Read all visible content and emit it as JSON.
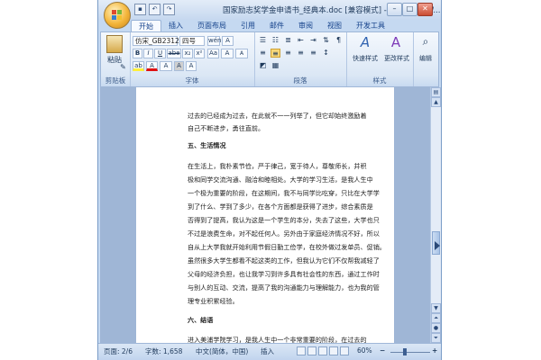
{
  "window": {
    "title": "国家励志奖学金申请书_经典本.doc [兼容模式] - Microsoft W...",
    "min_label": "–",
    "max_label": "□",
    "close_label": "✕"
  },
  "tabs": [
    "开始",
    "插入",
    "页面布局",
    "引用",
    "邮件",
    "审阅",
    "视图",
    "开发工具"
  ],
  "ribbon": {
    "clipboard": {
      "label": "剪贴板",
      "paste_label": "粘贴"
    },
    "font": {
      "label": "字体",
      "font_name": "仿宋_GB2312",
      "font_size": "四号",
      "wen": "wén",
      "a_big": "A",
      "a_small": "A",
      "aa": "Aa",
      "bold": "B",
      "italic": "I",
      "underline": "U",
      "strike": "abe",
      "sub": "x₂",
      "sup": "x²",
      "highlight": "ab",
      "font_color": "A",
      "clear": "A"
    },
    "paragraph": {
      "label": "段落"
    },
    "styles": {
      "label": "样式",
      "quick_styles": "快速样式",
      "change_styles": "更改样式"
    },
    "editing": {
      "label": "编辑"
    }
  },
  "document": {
    "lines": [
      "过去的已经成为过去，在此就不一一列举了，但它却始终激励着",
      "自己不断进步，勇往直前。",
      "五、生活情况",
      "在生活上，我朴素节俭，严于律己，宽于待人，尊敬师长，并积",
      "极和同学交流沟通、融洽和睦相处。大学的学习生活，是我人生中",
      "一个极为重要的阶段，在这期间，我不与同学比吃穿，只比在大学学",
      "到了什么、学到了多少，在各个方面都是获得了进步，综合素质是",
      "否得到了提高，我认为这是一个学生的本分，失去了这些，大学也只",
      "不过是浪费生命，对不起任何人。另外由于家庭经济情况不好，所以",
      "自从上大学我就开始利用节假日勤工俭学，在校外做过发单员、促销。",
      "虽然很多大学生都看不起这类的工作，但我认为它们不仅帮我减轻了",
      "父母的经济负担，也让我学习到许多具有社会性的东西，通过工作时",
      "与别人的互动、交流，提高了我的沟通能力与理解能力，也为我的管",
      "理专业积累经验。",
      "六、结语",
      "进入美浦学院学习，是我人生中一个非常重要的阶段，在过去的"
    ]
  },
  "status": {
    "page": "页面: 2/6",
    "words": "字数: 1,658",
    "language": "中文(简体，中国)",
    "mode": "插入",
    "zoom": "60%"
  }
}
